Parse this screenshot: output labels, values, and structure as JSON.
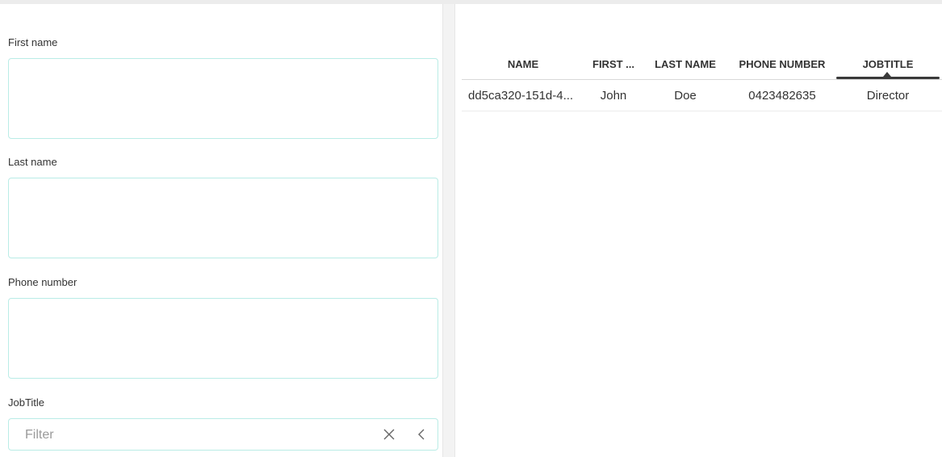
{
  "form": {
    "first_name_label": "First name",
    "first_name_value": "",
    "last_name_label": "Last name",
    "last_name_value": "",
    "phone_number_label": "Phone number",
    "phone_number_value": "",
    "jobtitle_label": "JobTitle",
    "jobtitle_filter_placeholder": "Filter",
    "clear_icon": "close-icon",
    "expand_icon": "chevron-left-icon"
  },
  "grid": {
    "columns": [
      "NAME",
      "FIRST ...",
      "LAST NAME",
      "PHONE NUMBER",
      "JOBTITLE"
    ],
    "sorted_column": "JOBTITLE",
    "rows": [
      {
        "name": "dd5ca320-151d-4...",
        "first_name": "John",
        "last_name": "Doe",
        "phone_number": "0423482635",
        "jobtitle": "Director"
      }
    ]
  }
}
